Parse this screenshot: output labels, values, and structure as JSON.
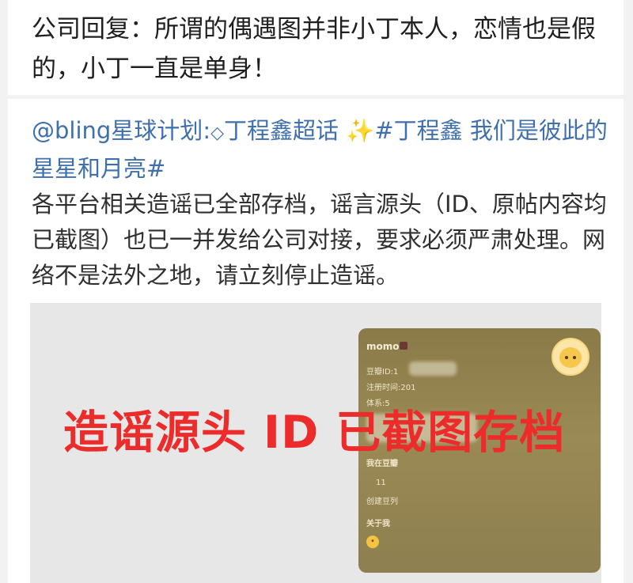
{
  "reply": {
    "text": "公司回复：所谓的偶遇图并非小丁本人，恋情也是假的，小丁一直是单身！"
  },
  "post": {
    "mention": "@bling星球计划",
    "colon": ":",
    "supertopic_icon": "diamond-icon",
    "supertopic": "丁程鑫超话",
    "sparkle": "✨",
    "hashtag": "#丁程鑫 我们是彼此的星星和月亮#",
    "body": "各平台相关造谣已全部存档，谣言源头（ID、原帖内容均已截图）也已一并发给公司对接，要求必须严肃处理。网络不是法外之地，请立刻停止造谣。"
  },
  "image": {
    "overlay_text": "造谣源头 ID 已截图存档",
    "phone": {
      "username": "momo",
      "line1": "豆瓣ID:1",
      "line2": "注册时间:201",
      "line3": "体系:5",
      "section1": "我在豆瓣",
      "count": "11",
      "count_label": "创建豆列",
      "section2": "关于我"
    }
  },
  "colors": {
    "link": "#3e6fae",
    "overlay": "#ec2b2b",
    "background": "#f2f2f2"
  }
}
